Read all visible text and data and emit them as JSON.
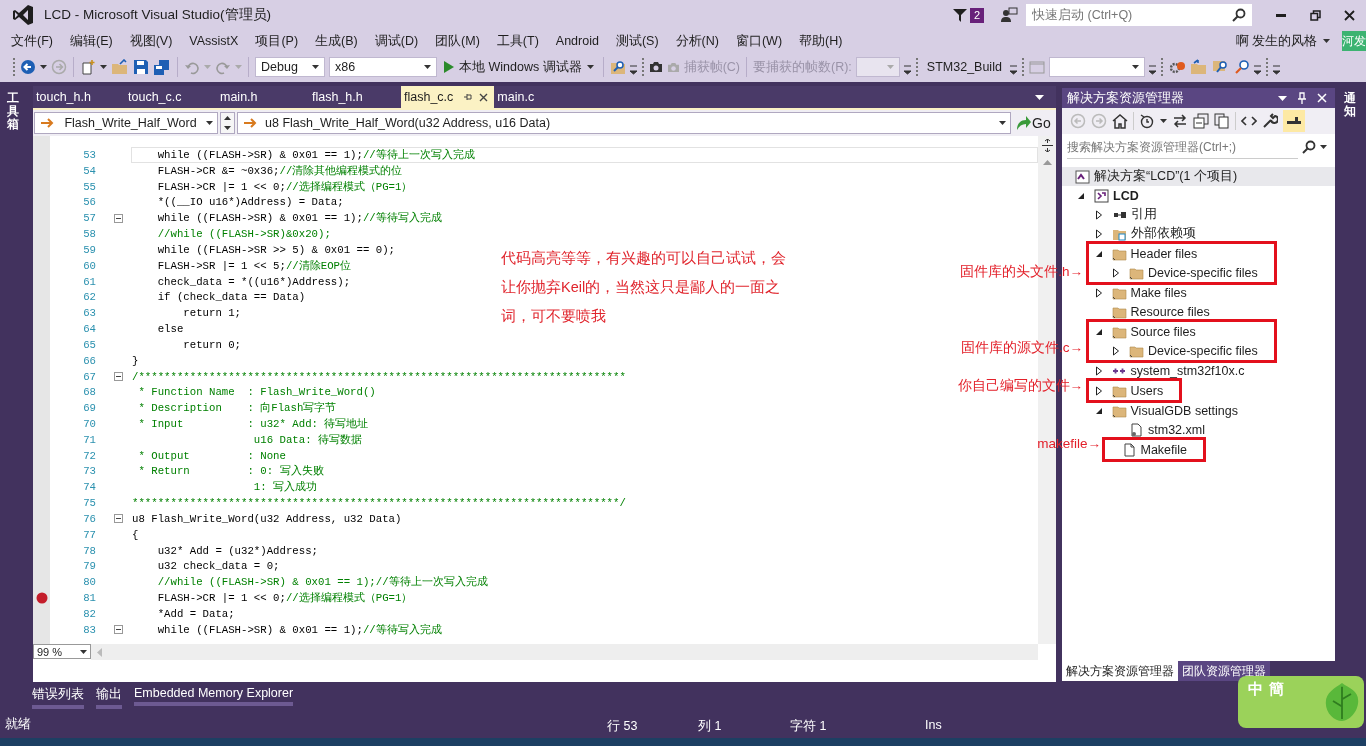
{
  "window": {
    "title": "LCD - Microsoft Visual Studio(管理员)",
    "notification_count": "2",
    "quick_launch": {
      "placeholder": "快速启动 (Ctrl+Q)"
    }
  },
  "menu": [
    {
      "label": "文件(F)"
    },
    {
      "label": "编辑(E)"
    },
    {
      "label": "视图(V)"
    },
    {
      "label": "VAssistX"
    },
    {
      "label": "项目(P)"
    },
    {
      "label": "生成(B)"
    },
    {
      "label": "调试(D)"
    },
    {
      "label": "团队(M)"
    },
    {
      "label": "工具(T)"
    },
    {
      "label": "Android"
    },
    {
      "label": "测试(S)"
    },
    {
      "label": "分析(N)"
    },
    {
      "label": "窗口(W)"
    },
    {
      "label": "帮助(H)"
    }
  ],
  "account": {
    "name": "啊 发生的风格",
    "avatar": "河发"
  },
  "toolbar": {
    "configuration": "Debug",
    "platform": "x86",
    "debugger": "本地 Windows 调试器",
    "capture": {
      "disabled": true,
      "frame_button": "捕获帧(C)",
      "frame_count_label": "要捕获的帧数(R):"
    },
    "build_target": "STM32_Build"
  },
  "side_strips": {
    "left": "工具箱",
    "right": "通知"
  },
  "editor": {
    "tabs": [
      {
        "label": "touch_h.h",
        "selected": false
      },
      {
        "label": "touch_c.c",
        "selected": false
      },
      {
        "label": "main.h",
        "selected": false
      },
      {
        "label": "flash_h.h",
        "selected": false
      },
      {
        "label": "flash_c.c",
        "selected": true
      },
      {
        "label": "main.c",
        "selected": false
      }
    ],
    "navigation": {
      "scope": "Flash_Write_Half_Word",
      "member": "u8 Flash_Write_Half_Word(u32 Address, u16 Data)",
      "go": "Go"
    },
    "lines": [
      {
        "n": "53",
        "code": "    while ((FLASH->SR) & 0x01 == 1);",
        "comment": "//等待上一次写入完成",
        "fold": false,
        "breakpoint": false,
        "current": true
      },
      {
        "n": "54",
        "code": "    FLASH->CR &= ~0x36;",
        "comment": "//清除其他编程模式的位",
        "fold": false,
        "breakpoint": false,
        "current": false
      },
      {
        "n": "55",
        "code": "    FLASH->CR |= 1 << 0;",
        "comment": "//选择编程模式（PG=1）",
        "fold": false,
        "breakpoint": false,
        "current": false
      },
      {
        "n": "56",
        "code": "    *((__IO u16*)Address) = Data;",
        "fold": false,
        "breakpoint": false,
        "current": false
      },
      {
        "n": "57",
        "code": "    while ((FLASH->SR) & 0x01 == 1);",
        "comment": "//等待写入完成",
        "fold": true,
        "breakpoint": false,
        "current": false
      },
      {
        "n": "58",
        "comment": "    //while ((FLASH->SR)&0x20);",
        "fold": false,
        "breakpoint": false,
        "current": false
      },
      {
        "n": "59",
        "code": "    while ((FLASH->SR >> 5) & 0x01 == 0);",
        "fold": false,
        "breakpoint": false,
        "current": false
      },
      {
        "n": "60",
        "code": "    FLASH->SR |= 1 << 5;",
        "comment": "//清除EOP位",
        "fold": false,
        "breakpoint": false,
        "current": false
      },
      {
        "n": "61",
        "code": "    check_data = *((u16*)Address);",
        "fold": false,
        "breakpoint": false,
        "current": false
      },
      {
        "n": "62",
        "code": "    if (check_data == Data)",
        "fold": false,
        "breakpoint": false,
        "current": false
      },
      {
        "n": "63",
        "code": "        return 1;",
        "fold": false,
        "breakpoint": false,
        "current": false
      },
      {
        "n": "64",
        "code": "    else",
        "fold": false,
        "breakpoint": false,
        "current": false
      },
      {
        "n": "65",
        "code": "        return 0;",
        "fold": false,
        "breakpoint": false,
        "current": false
      },
      {
        "n": "66",
        "code": "}",
        "fold": false,
        "breakpoint": false,
        "current": false
      },
      {
        "n": "67",
        "comment": "/****************************************************************************",
        "fold": true,
        "breakpoint": false,
        "current": false
      },
      {
        "n": "68",
        "comment": " * Function Name  : Flash_Write_Word()",
        "fold": false,
        "breakpoint": false,
        "current": false
      },
      {
        "n": "69",
        "comment": " * Description    : 向Flash写字节",
        "fold": false,
        "breakpoint": false,
        "current": false
      },
      {
        "n": "70",
        "comment": " * Input          : u32* Add: 待写地址",
        "fold": false,
        "breakpoint": false,
        "current": false
      },
      {
        "n": "71",
        "comment": "                   u16 Data: 待写数据",
        "fold": false,
        "breakpoint": false,
        "current": false
      },
      {
        "n": "72",
        "comment": " * Output         : None",
        "fold": false,
        "breakpoint": false,
        "current": false
      },
      {
        "n": "73",
        "comment": " * Return         : 0: 写入失败",
        "fold": false,
        "breakpoint": false,
        "current": false
      },
      {
        "n": "74",
        "comment": "                   1: 写入成功",
        "fold": false,
        "breakpoint": false,
        "current": false
      },
      {
        "n": "75",
        "comment": "****************************************************************************/",
        "fold": false,
        "breakpoint": false,
        "current": false
      },
      {
        "n": "76",
        "code": "u8 Flash_Write_Word(u32 Address, u32 Data)",
        "fold": true,
        "breakpoint": false,
        "current": false
      },
      {
        "n": "77",
        "code": "{",
        "fold": false,
        "breakpoint": false,
        "current": false
      },
      {
        "n": "78",
        "code": "    u32* Add = (u32*)Address;",
        "fold": false,
        "breakpoint": false,
        "current": false
      },
      {
        "n": "79",
        "code": "    u32 check_data = 0;",
        "fold": false,
        "breakpoint": false,
        "current": false
      },
      {
        "n": "80",
        "comment": "    //while ((FLASH->SR) & 0x01 == 1);//等待上一次写入完成",
        "fold": false,
        "breakpoint": false,
        "current": false
      },
      {
        "n": "81",
        "code": "    FLASH->CR |= 1 << 0;",
        "comment": "//选择编程模式（PG=1）",
        "fold": false,
        "breakpoint": true,
        "current": false
      },
      {
        "n": "82",
        "code": "    *Add = Data;",
        "fold": false,
        "breakpoint": false,
        "current": false
      },
      {
        "n": "83",
        "code": "    while ((FLASH->SR) & 0x01 == 1);",
        "comment": "//等待写入完成",
        "fold": true,
        "breakpoint": false,
        "current": false
      }
    ],
    "zoom": "99 %"
  },
  "solution_explorer": {
    "title": "解决方案资源管理器",
    "search": {
      "placeholder": "搜索解决方案资源管理器(Ctrl+;)"
    },
    "tree": [
      {
        "label": "解决方案“LCD”(1 个项目)",
        "kind": "solution",
        "children": [
          {
            "label": "LCD",
            "kind": "project",
            "expanded": true,
            "children": [
              {
                "label": "引用",
                "kind": "references",
                "expanded": false,
                "highlighted": false
              },
              {
                "label": "外部依赖项",
                "kind": "external",
                "expanded": false,
                "highlighted": false
              },
              {
                "label": "Header files",
                "kind": "folder",
                "expanded": true,
                "highlighted": true,
                "children": [
                  {
                    "label": "Device-specific files",
                    "kind": "folder",
                    "expanded": false
                  }
                ]
              },
              {
                "label": "Make files",
                "kind": "folder",
                "expanded": false,
                "highlighted": false
              },
              {
                "label": "Resource files",
                "kind": "folder",
                "highlighted": false
              },
              {
                "label": "Source files",
                "kind": "folder",
                "expanded": true,
                "highlighted": true,
                "children": [
                  {
                    "label": "Device-specific files",
                    "kind": "folder",
                    "expanded": false
                  }
                ]
              },
              {
                "label": "system_stm32f10x.c",
                "kind": "source",
                "expanded": false,
                "highlighted": false
              },
              {
                "label": "Users",
                "kind": "folder",
                "expanded": false,
                "highlighted": true
              },
              {
                "label": "VisualGDB settings",
                "kind": "folder",
                "expanded": true,
                "highlighted": false,
                "children": [
                  {
                    "label": "stm32.xml",
                    "kind": "xml"
                  }
                ]
              },
              {
                "label": "Makefile",
                "kind": "file",
                "highlighted": true
              }
            ]
          }
        ]
      }
    ],
    "tabs": [
      {
        "label": "解决方案资源管理器",
        "selected": true
      },
      {
        "label": "团队资源管理器",
        "selected": false
      }
    ]
  },
  "annotations": {
    "note": "代码高亮等等，有兴趣的可以自己试试，会让你抛弃Keil的，当然这只是鄙人的一面之词，可不要喷我",
    "callouts": [
      {
        "text": "固件库的头文件.h→"
      },
      {
        "text": "固件库的源文件.c→"
      },
      {
        "text": "你自己编写的文件→"
      },
      {
        "text": "makefile→"
      }
    ]
  },
  "tool_tabs": [
    {
      "label": "错误列表"
    },
    {
      "label": "输出"
    },
    {
      "label": "Embedded Memory Explorer"
    }
  ],
  "status_bar": {
    "state": "就绪",
    "line": "行 53",
    "column": "列 1",
    "char": "字符 1",
    "mode": "Ins"
  },
  "ime_toolbar": {
    "mode": "中",
    "script": "簡"
  }
}
